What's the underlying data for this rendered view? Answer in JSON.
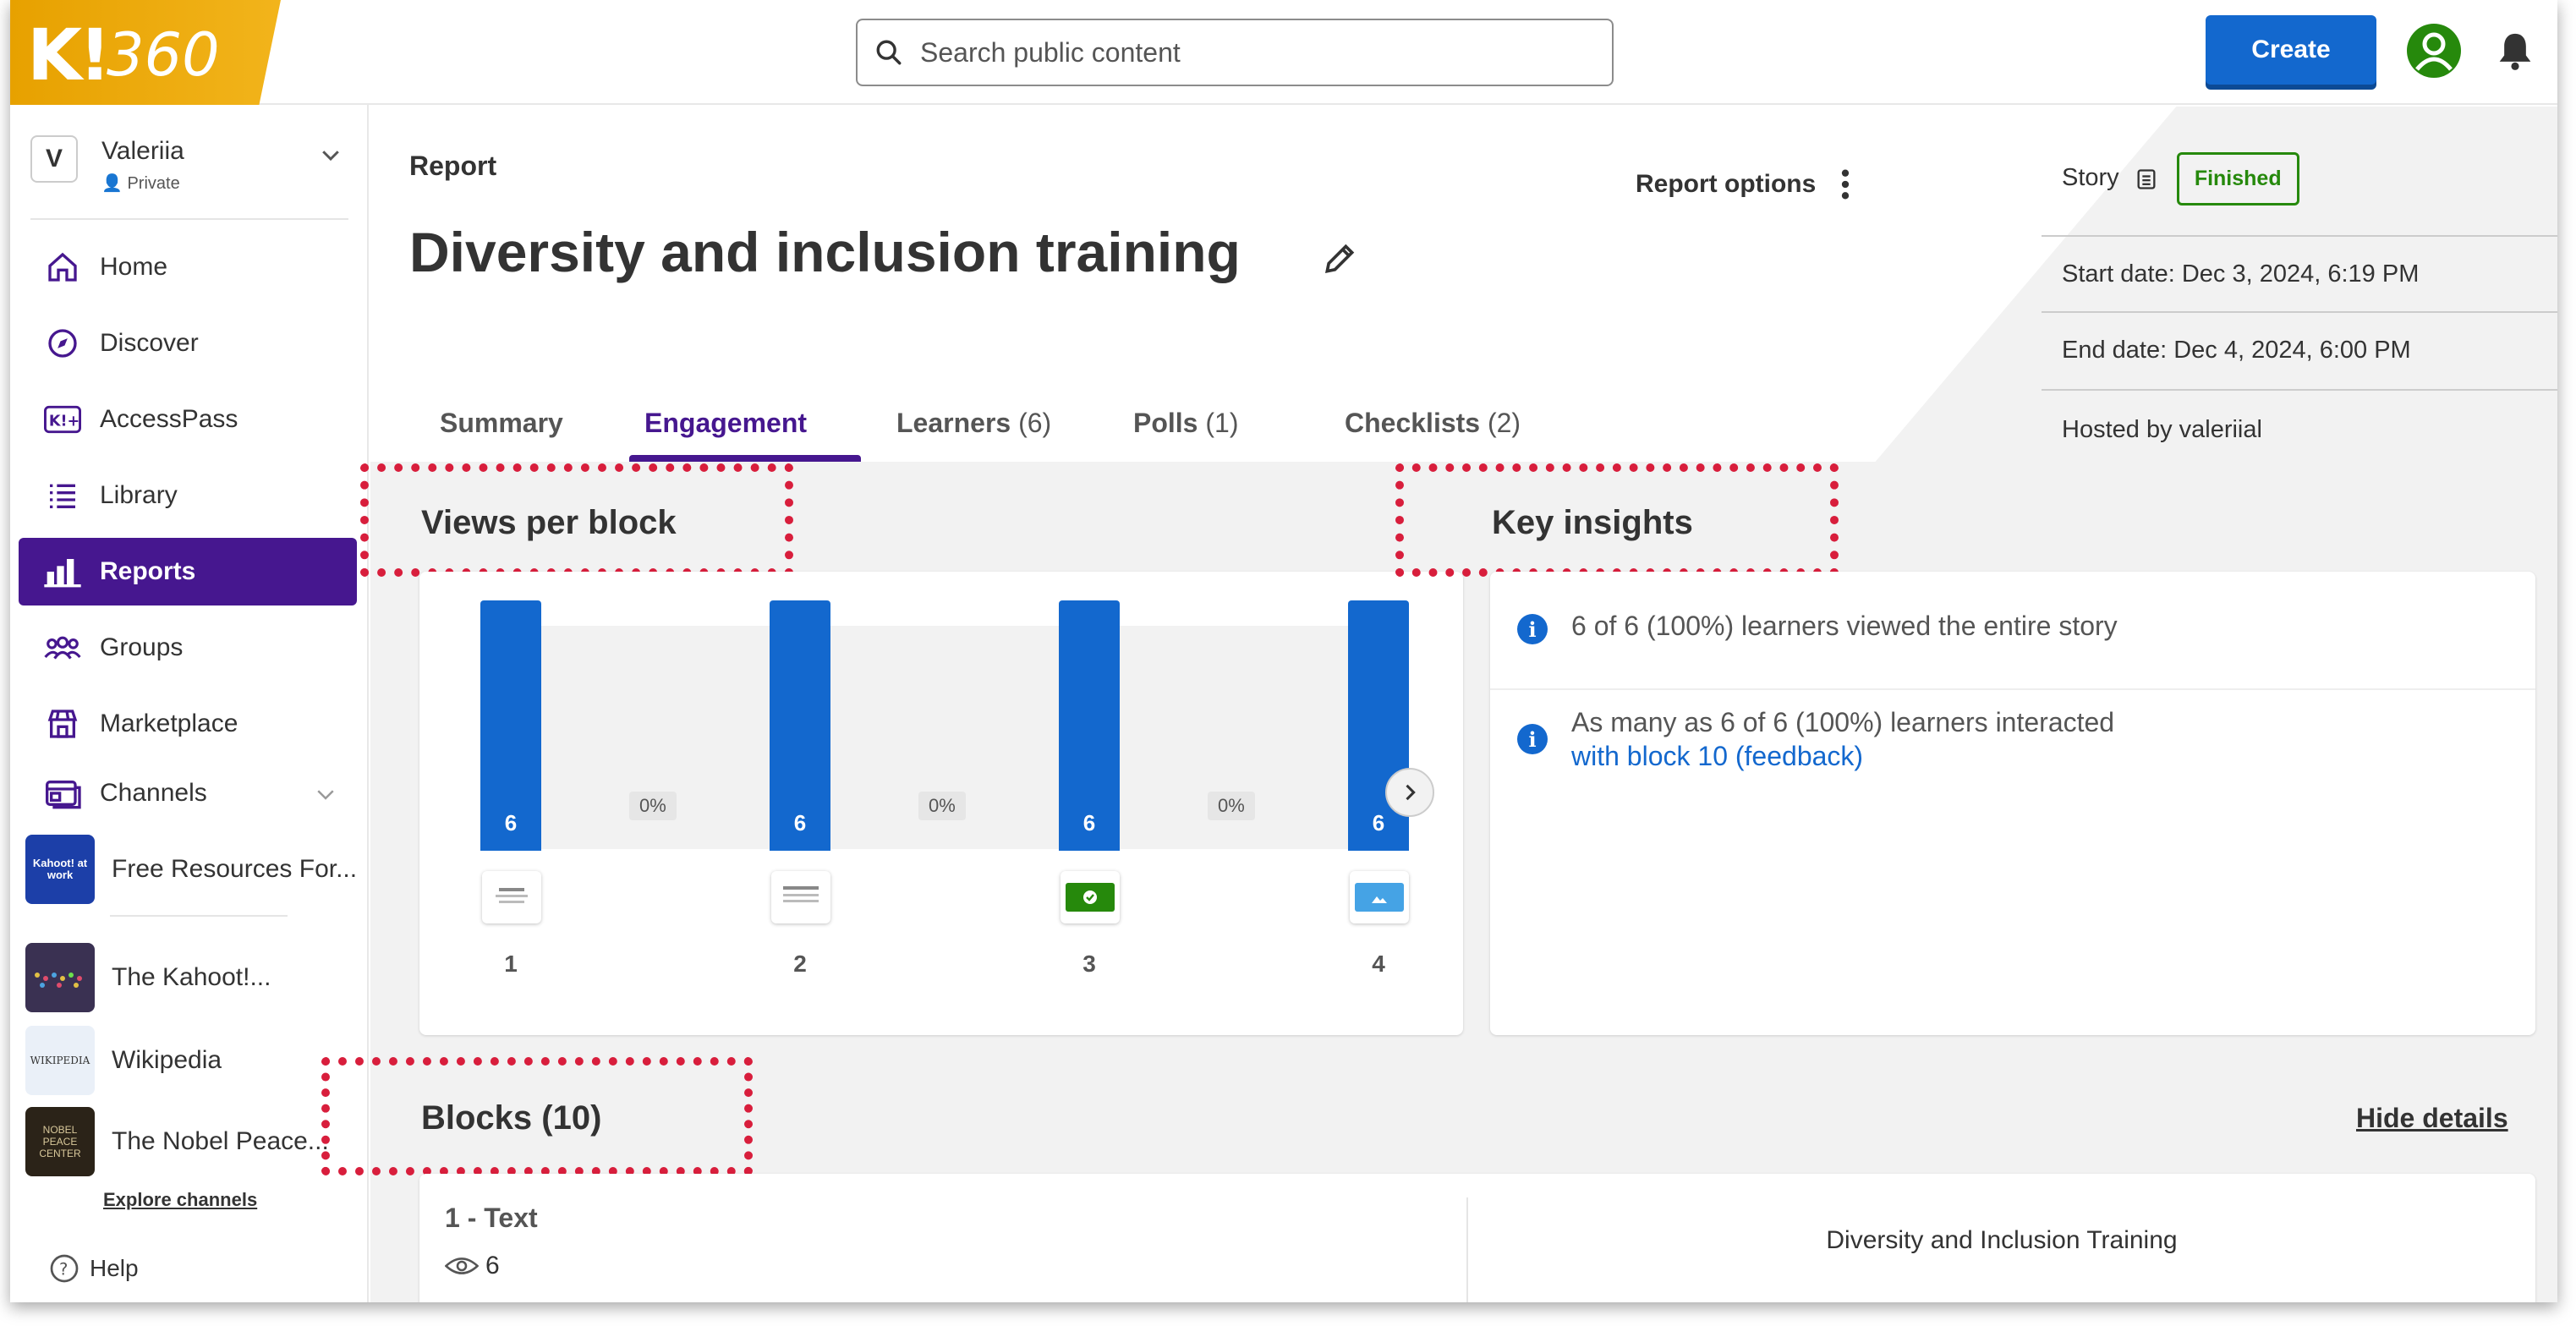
{
  "topbar": {
    "logo_k": "K!",
    "logo_360": "360",
    "search_placeholder": "Search public content",
    "create_label": "Create"
  },
  "sidebar": {
    "workspace": {
      "letter": "V",
      "name": "Valeriia",
      "privacy": "Private"
    },
    "items": [
      {
        "label": "Home",
        "icon": "home-icon"
      },
      {
        "label": "Discover",
        "icon": "compass-icon"
      },
      {
        "label": "AccessPass",
        "icon": "accesspass-icon"
      },
      {
        "label": "Library",
        "icon": "list-icon"
      },
      {
        "label": "Reports",
        "icon": "bar-chart-icon",
        "active": true
      },
      {
        "label": "Groups",
        "icon": "groups-icon"
      },
      {
        "label": "Marketplace",
        "icon": "store-icon"
      },
      {
        "label": "Channels",
        "icon": "channels-icon"
      }
    ],
    "channels": [
      {
        "name": "Free Resources For...",
        "thumb_text": "Kahoot! at work",
        "thumb_color": "#1c3fa8"
      },
      {
        "name": "The Kahoot!...",
        "thumb_text": "",
        "thumb_color": "#3a3152"
      },
      {
        "name": "Wikipedia",
        "thumb_text": "WIKIPEDIA",
        "thumb_color": "#eaf0f8"
      },
      {
        "name": "The Nobel Peace...",
        "thumb_text": "NOBEL PEACE CENTER",
        "thumb_color": "#2b2318"
      }
    ],
    "explore_label": "Explore channels",
    "help_label": "Help"
  },
  "report": {
    "label": "Report",
    "title": "Diversity and inclusion training",
    "options_label": "Report options",
    "tabs": [
      {
        "label": "Summary",
        "count": ""
      },
      {
        "label": "Engagement",
        "count": ""
      },
      {
        "label": "Learners",
        "count": "(6)"
      },
      {
        "label": "Polls",
        "count": "(1)"
      },
      {
        "label": "Checklists",
        "count": "(2)"
      }
    ]
  },
  "info": {
    "type_label": "Story",
    "status": "Finished",
    "start": "Start date: Dec 3, 2024, 6:19 PM",
    "end": "End date: Dec 4, 2024, 6:00 PM",
    "host": "Hosted by valeriial"
  },
  "views_per_block": {
    "title": "Views per block",
    "blocks": [
      {
        "num": "1",
        "views": "6",
        "type": "text"
      },
      {
        "num": "2",
        "views": "6",
        "type": "text"
      },
      {
        "num": "3",
        "views": "6",
        "type": "check"
      },
      {
        "num": "4",
        "views": "6",
        "type": "image"
      }
    ],
    "dropoffs": [
      "0%",
      "0%",
      "0%"
    ]
  },
  "key_insights": {
    "title": "Key insights",
    "items": [
      {
        "text": "6 of 6 (100%) learners viewed the entire story",
        "link": ""
      },
      {
        "text": "As many as 6 of 6 (100%) learners interacted",
        "link": "with block 10 (feedback)"
      }
    ]
  },
  "blocks_section": {
    "title": "Blocks (10)",
    "hide_label": "Hide details",
    "first": {
      "name": "1 - Text",
      "views": "6",
      "preview": "Diversity and Inclusion Training"
    }
  },
  "colors": {
    "accent_blue": "#1368ce",
    "purple": "#46178f",
    "success": "#26890c",
    "gold": "#f2b41b",
    "highlight": "#d81e3c"
  }
}
